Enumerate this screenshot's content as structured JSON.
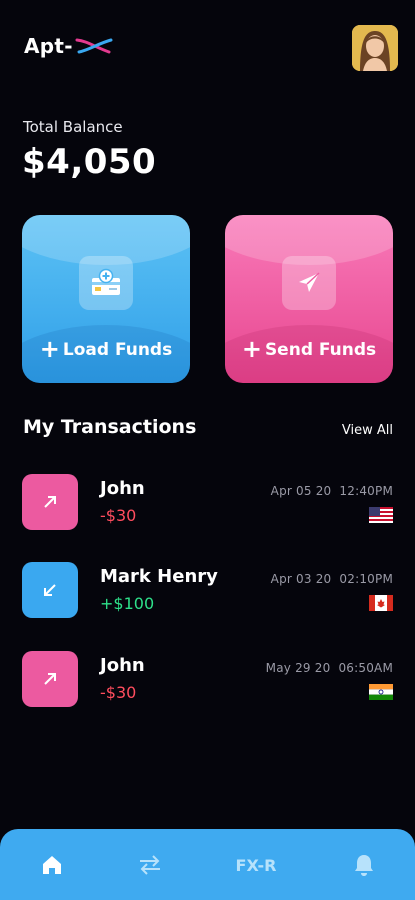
{
  "header": {
    "logo_text": "Apt-",
    "logo_accent_colors": [
      "#e23a8f",
      "#3aa8f0"
    ]
  },
  "balance": {
    "label": "Total Balance",
    "value": "$4,050"
  },
  "actions": {
    "load": {
      "label": "Load Funds",
      "color": "#45b2f0"
    },
    "send": {
      "label": "Send Funds",
      "color": "#ef5fa5"
    }
  },
  "transactions_section": {
    "title": "My Transactions",
    "view_all": "View All"
  },
  "transactions": [
    {
      "name": "John",
      "amount": "-$30",
      "date": "Apr 05 20",
      "time": "12:40PM",
      "direction": "outgoing",
      "icon": "arrow-up-right-icon",
      "flag": "us-flag-icon"
    },
    {
      "name": "Mark Henry",
      "amount": "+$100",
      "date": "Apr 03 20",
      "time": "02:10PM",
      "direction": "incoming",
      "icon": "arrow-down-left-icon",
      "flag": "canada-flag-icon"
    },
    {
      "name": "John",
      "amount": "-$30",
      "date": "May 29 20",
      "time": "06:50AM",
      "direction": "outgoing",
      "icon": "arrow-up-right-icon",
      "flag": "india-flag-icon"
    }
  ],
  "colors": {
    "negative": "#ff4d5e",
    "positive": "#2ee08a",
    "outgoing_bg": "#ec5aa0",
    "incoming_bg": "#3aa8f0",
    "background": "#05050c",
    "nav_bg": "#3faaf0"
  },
  "navbar": {
    "items": [
      "home-icon",
      "transfer-icon",
      "FX-R",
      "bell-icon"
    ],
    "fx_label": "FX-R",
    "active": "home-icon"
  }
}
